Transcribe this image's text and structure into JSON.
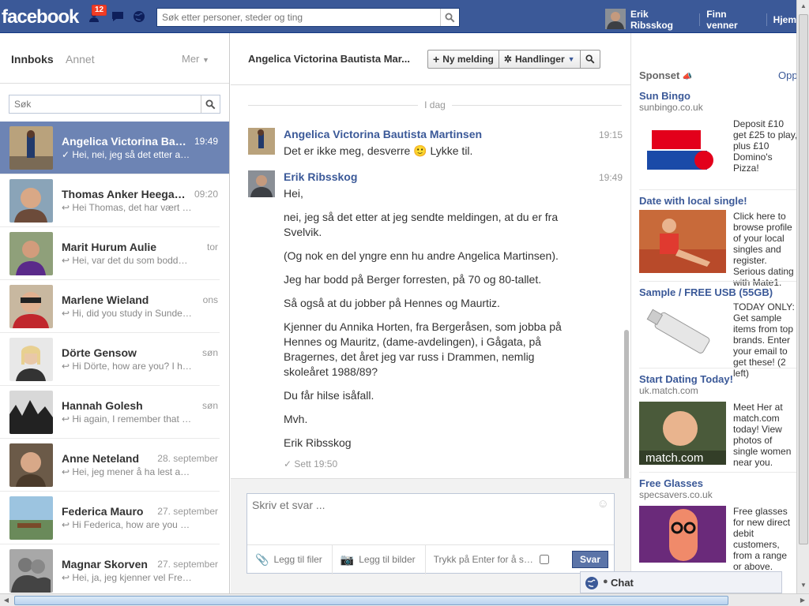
{
  "topbar": {
    "logo": "facebook",
    "notification_count": "12",
    "search_placeholder": "Søk etter personer, steder og ting",
    "user_name": "Erik Ribsskog",
    "find_friends": "Finn venner",
    "home": "Hjem"
  },
  "inbox": {
    "tab_inbox": "Innboks",
    "tab_other": "Annet",
    "more": "Mer",
    "search_placeholder": "Søk",
    "threads": [
      {
        "name": "Angelica Victorina Bautista Martinsen",
        "time": "19:49",
        "snippet": "Hei, nei, jeg så det etter at jeg sendte meldingen"
      },
      {
        "name": "Thomas Anker Heegaard",
        "time": "09:20",
        "snippet": "Hei Thomas, det har vært lenge siden"
      },
      {
        "name": "Marit Hurum Aulie",
        "time": "tor",
        "snippet": "Hei, var det du som bodde på Berger"
      },
      {
        "name": "Marlene Wieland",
        "time": "ons",
        "snippet": "Hi, did you study in Sunderland"
      },
      {
        "name": "Dörte Gensow",
        "time": "søn",
        "snippet": "Hi Dörte, how are you? I hope you are fine"
      },
      {
        "name": "Hannah Golesh",
        "time": "søn",
        "snippet": "Hi again, I remember that you were"
      },
      {
        "name": "Anne Neteland",
        "time": "28. september",
        "snippet": "Hei, jeg mener å ha lest at du"
      },
      {
        "name": "Federica Mauro",
        "time": "27. september",
        "snippet": "Hi Federica, how are you doing"
      },
      {
        "name": "Magnar Skorven",
        "time": "27. september",
        "snippet": "Hei, ja, jeg kjenner vel Fredrik"
      }
    ]
  },
  "conversation": {
    "title": "Angelica Victorina Bautista Mar...",
    "new_message": "Ny melding",
    "actions": "Handlinger",
    "day_label": "I dag",
    "messages": [
      {
        "sender": "Angelica Victorina Bautista Martinsen",
        "time": "19:15",
        "paragraphs": [
          "Det er ikke meg, desverre 🙂 Lykke til."
        ]
      },
      {
        "sender": "Erik Ribsskog",
        "time": "19:49",
        "paragraphs": [
          "Hei,",
          "nei, jeg så det etter at jeg sendte meldingen, at du er fra Svelvik.",
          "(Og nok en del yngre enn hu andre Angelica Martinsen).",
          "Jeg har bodd på Berger forresten, på 70 og 80-tallet.",
          "Så også at du jobber på Hennes og Maurtiz.",
          "Kjenner du Annika Horten, fra Bergeråsen, som jobba på Hennes og Mauritz, (dame-avdelingen), i Gågata, på Bragernes, det året jeg var russ i Drammen, nemlig skoleåret 1988/89?",
          "Du får hilse isåfall.",
          "Mvh.",
          "Erik Ribsskog"
        ]
      }
    ],
    "seen": "Sett 19:50",
    "reply_placeholder": "Skriv et svar ...",
    "attach_files": "Legg til filer",
    "attach_photos": "Legg til bilder",
    "enter_to_send": "Trykk på Enter for å sende",
    "send": "Svar"
  },
  "sponsored": {
    "header": "Sponset",
    "create_ad": "Opprett en annonse",
    "ads": [
      {
        "title": "Sun Bingo",
        "domain": "sunbingo.co.uk",
        "text": "Deposit £10 get £25 to play, plus £10 Domino's Pizza!"
      },
      {
        "title": "Date with local single!",
        "domain": "",
        "text": "Click here to browse profile of your local singles and register. Serious dating with Mate1."
      },
      {
        "title": "Sample / FREE USB (55GB)",
        "domain": "",
        "text": "TODAY ONLY: Get sample items from top brands. Enter your email to get these! (2 left)"
      },
      {
        "title": "Start Dating Today!",
        "domain": "uk.match.com",
        "text": "Meet Her at match.com today! View photos of single women near you."
      },
      {
        "title": "Free Glasses",
        "domain": "specsavers.co.uk",
        "text": "Free glasses for new direct debit customers, from a range or above."
      }
    ]
  },
  "chat": {
    "label": "Chat"
  },
  "colors": {
    "brand": "#3b5998",
    "active_thread": "#6d84b4",
    "badge": "#f03d25"
  }
}
